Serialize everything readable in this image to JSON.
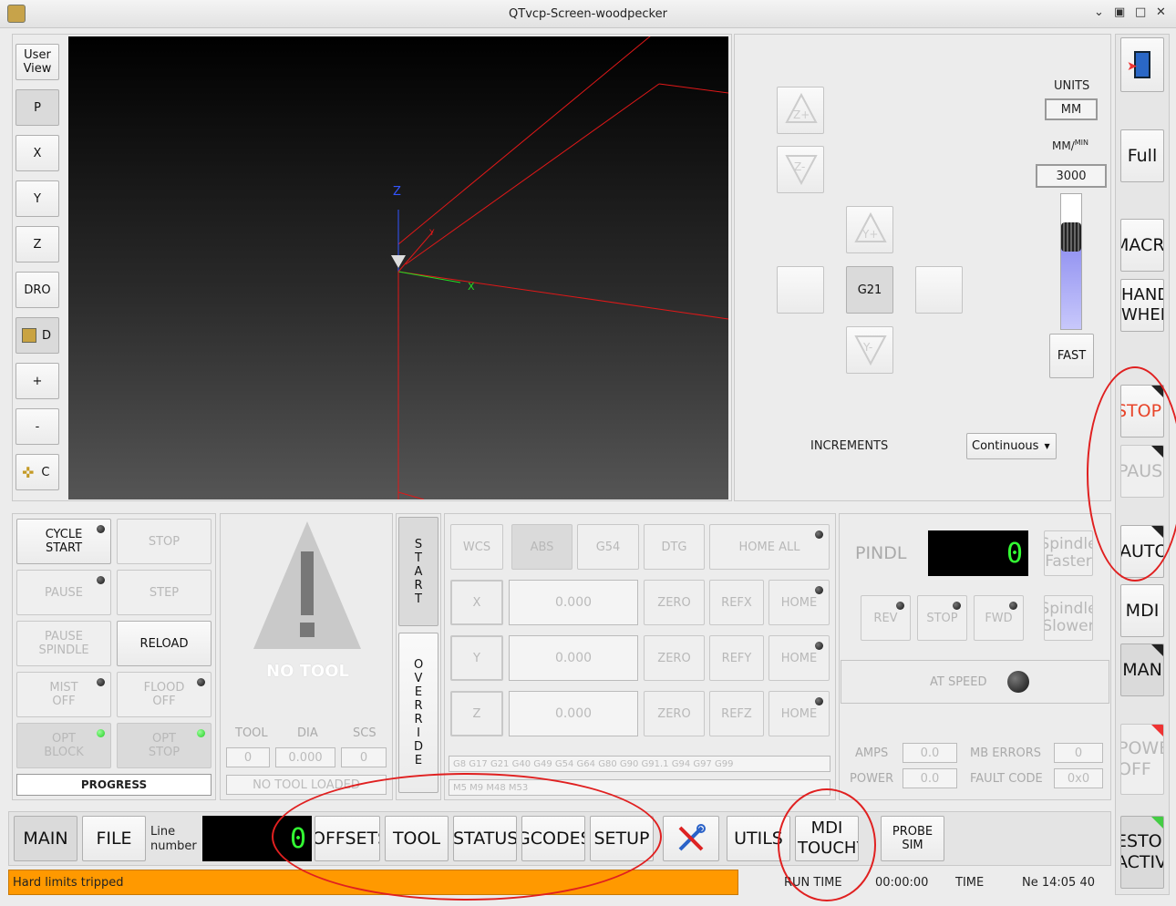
{
  "window": {
    "title": "QTvcp-Screen-woodpecker",
    "min": "⌄",
    "max": "□",
    "restore": "▣",
    "close": "✕"
  },
  "view_buttons": [
    "User View",
    "P",
    "X",
    "Y",
    "Z",
    "DRO",
    "D",
    "+",
    "-",
    "C"
  ],
  "preview": {
    "axis_z": "Z",
    "axis_x": "X",
    "axis_y": "Y"
  },
  "jog": {
    "z_plus": "Z+",
    "z_minus": "Z-",
    "y_plus": "Y+",
    "y_minus": "Y-",
    "center": "G21",
    "units_label": "UNITS",
    "units_value": "MM",
    "rate_label": "MM/",
    "rate_sup": "MIN",
    "rate_value": "3000",
    "fast": "FAST",
    "increments_label": "INCREMENTS",
    "increments_value": "Continuous",
    "rate_slider_fraction": 0.68
  },
  "right_column": [
    "Full",
    "MACRO",
    "HAND WHEEL",
    "STOP",
    "PAUSE",
    "AUTO",
    "MDI",
    "MAN",
    "POWER OFF",
    "ESTOP ACTIVE"
  ],
  "controls": {
    "cycle_start": "CYCLE START",
    "stop": "STOP",
    "pause": "PAUSE",
    "step": "STEP",
    "pause_spindle": "PAUSE SPINDLE",
    "reload": "RELOAD",
    "mist_off": "MIST OFF",
    "flood_off": "FLOOD OFF",
    "opt_block": "OPT BLOCK",
    "opt_stop": "OPT STOP",
    "progress": "PROGRESS"
  },
  "tool": {
    "no_tool": "NO TOOL",
    "tool_h": "TOOL",
    "dia_h": "DIA",
    "scs_h": "SCS",
    "tool_v": "0",
    "dia_v": "0.000",
    "scs_v": "0",
    "loaded": "NO TOOL LOADED"
  },
  "side_tabs": {
    "start": "START",
    "override": "OVERRIDE"
  },
  "dro": {
    "wcs": "WCS",
    "abs": "ABS",
    "g54": "G54",
    "dtg": "DTG",
    "home_all": "HOME ALL",
    "rows": [
      {
        "axis": "X",
        "value": "0.000",
        "zero": "ZERO",
        "ref": "REFX",
        "home": "HOME"
      },
      {
        "axis": "Y",
        "value": "0.000",
        "zero": "ZERO",
        "ref": "REFY",
        "home": "HOME"
      },
      {
        "axis": "Z",
        "value": "0.000",
        "zero": "ZERO",
        "ref": "REFZ",
        "home": "HOME"
      }
    ],
    "gcodes": "G8 G17 G21 G40 G49 G54 G64 G80 G90 G91.1 G94 G97 G99",
    "mcodes": "M5 M9 M48 M53"
  },
  "spindle": {
    "label": "PINDL",
    "value": "0",
    "faster": "Spindle Faster",
    "slower": "Spindle Slower",
    "rev": "REV",
    "stop": "STOP",
    "fwd": "FWD",
    "at_speed": "AT SPEED",
    "amps": "AMPS",
    "amps_v": "0.0",
    "power": "POWER",
    "power_v": "0.0",
    "mb_errors": "MB ERRORS",
    "mb_errors_v": "0",
    "fault_code": "FAULT CODE",
    "fault_code_v": "0x0"
  },
  "bottom": {
    "main": "MAIN",
    "file": "FILE",
    "line_label": "Line number",
    "line_value": "0",
    "offsets": "OFFSETS",
    "tool": "TOOL",
    "status": "STATUS",
    "gcodes": "GCODES",
    "setup": "SETUP",
    "utils": "UTILS",
    "mdi_touchy": "MDI TOUCHY",
    "probe_sim": "PROBE SIM"
  },
  "statusbar": {
    "message": "Hard limits tripped",
    "run_time_label": "RUN TIME",
    "run_time": "00:00:00",
    "time_label": "TIME",
    "time": "Ne 14:05 40"
  },
  "colors": {
    "status_bg": "#ff9900",
    "annotation": "#e02020",
    "led_green": "#33cc33"
  }
}
